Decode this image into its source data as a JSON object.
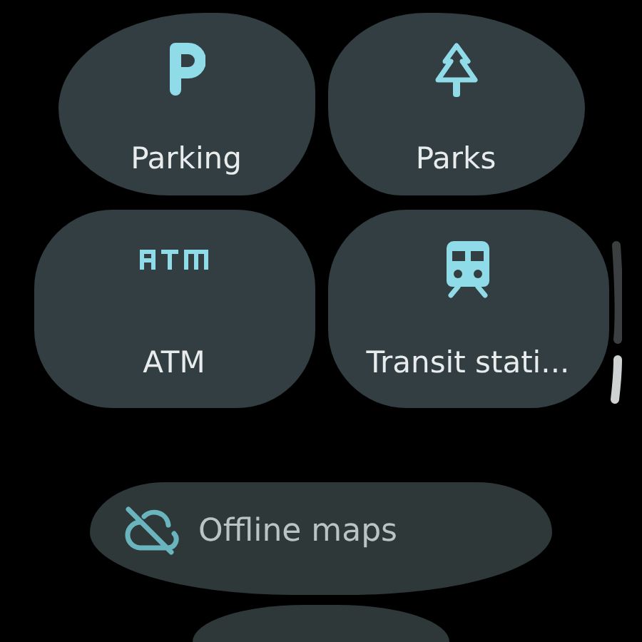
{
  "tiles": [
    {
      "label": "Parking"
    },
    {
      "label": "Parks"
    },
    {
      "label": "ATM"
    },
    {
      "label": "Transit stati..."
    }
  ],
  "chip": {
    "label": "Offline maps"
  }
}
